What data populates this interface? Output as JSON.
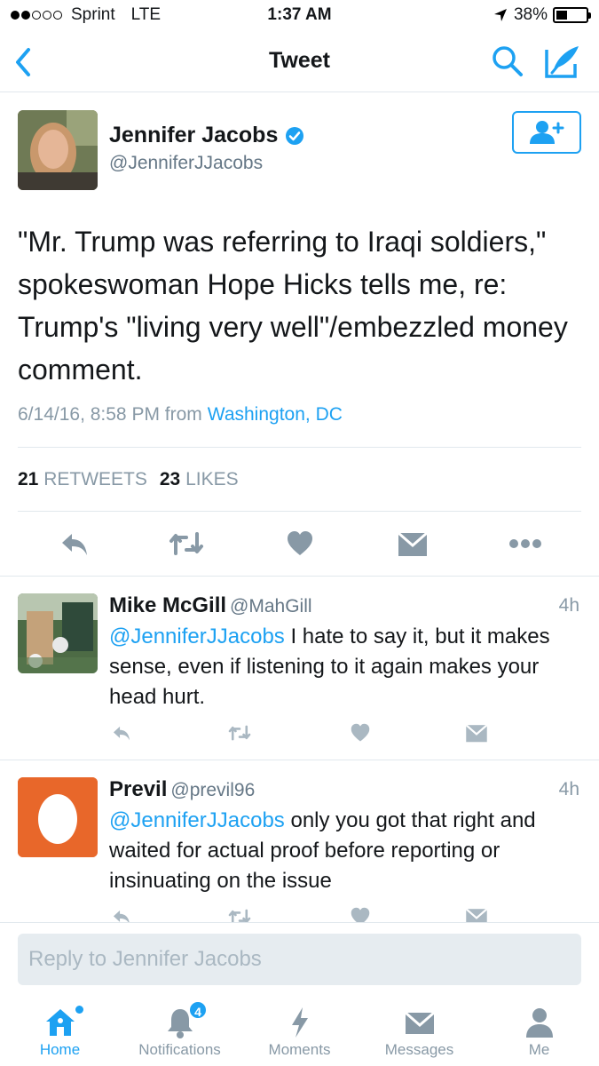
{
  "status_bar": {
    "carrier": "Sprint",
    "network": "LTE",
    "time": "1:37 AM",
    "battery": "38%"
  },
  "nav": {
    "title": "Tweet"
  },
  "tweet": {
    "author_name": "Jennifer Jacobs",
    "author_handle": "@JenniferJJacobs",
    "text": "\"Mr. Trump was referring to Iraqi soldiers,\" spokeswoman Hope Hicks tells me, re: Trump's \"living very well\"/embezzled money comment.",
    "timestamp": "6/14/16, 8:58 PM from",
    "location": "Washington, DC",
    "retweets_count": "21",
    "retweets_label": "RETWEETS",
    "likes_count": "23",
    "likes_label": "LIKES"
  },
  "replies": [
    {
      "name": "Mike McGill",
      "handle": "@MahGill",
      "time": "4h",
      "mention": "@JenniferJJacobs",
      "text": " I hate to say it, but it makes sense, even if listening to it again makes your head hurt."
    },
    {
      "name": "Previl",
      "handle": "@previl96",
      "time": "4h",
      "mention": "@JenniferJJacobs",
      "text": " only you got that right and waited for actual proof before reporting or insinuating on the issue"
    }
  ],
  "reply_bar": {
    "placeholder": "Reply to Jennifer Jacobs"
  },
  "tabs": [
    {
      "label": "Home",
      "icon": "home-icon"
    },
    {
      "label": "Notifications",
      "icon": "bell-icon",
      "badge": "4"
    },
    {
      "label": "Moments",
      "icon": "lightning-icon"
    },
    {
      "label": "Messages",
      "icon": "envelope-icon"
    },
    {
      "label": "Me",
      "icon": "person-icon"
    }
  ],
  "colors": {
    "accent": "#1da1f2",
    "muted": "#8899a6",
    "icon_gray": "#aab8c2",
    "egg_bg": "#e8672a"
  }
}
